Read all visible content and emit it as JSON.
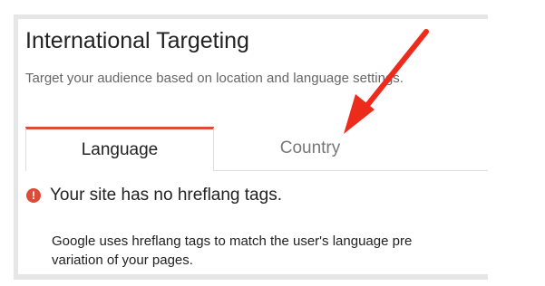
{
  "panel": {
    "title": "International Targeting",
    "subtitle": "Target your audience based on location and language settings."
  },
  "tabs": [
    {
      "label": "Language",
      "active": true
    },
    {
      "label": "Country",
      "active": false
    }
  ],
  "alert": {
    "icon": "exclamation",
    "text": "Your site has no hreflang tags."
  },
  "description": {
    "line1": "Google uses hreflang tags to match the user's language pre",
    "line2": "variation of your pages."
  },
  "colors": {
    "accent": "#dd4b39",
    "arrow": "#ec2b1c"
  }
}
